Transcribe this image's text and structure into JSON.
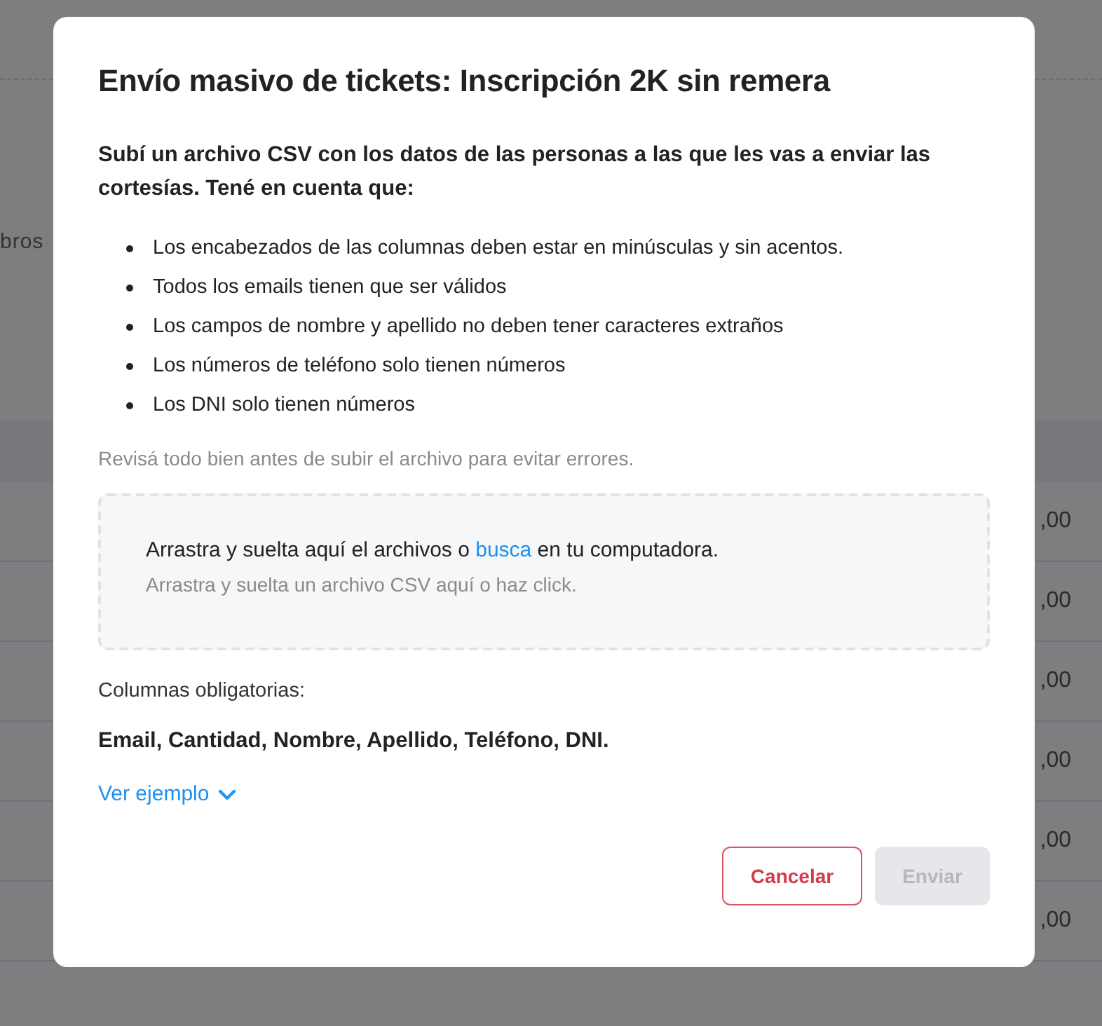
{
  "background": {
    "side_text": "bros",
    "amounts": [
      ",00",
      ",00",
      ",00",
      ",00",
      ",00",
      ",00"
    ]
  },
  "modal": {
    "title": "Envío masivo de tickets: Inscripción 2K sin remera",
    "intro": "Subí un archivo CSV con los datos de las personas a las que les vas a enviar las cortesías. Tené en cuenta que:",
    "rules": [
      "Los encabezados de las columnas deben estar en minúsculas y sin acentos.",
      "Todos los emails tienen que ser válidos",
      "Los campos de nombre y apellido no deben tener caracteres extraños",
      "Los números de teléfono solo tienen números",
      "Los DNI solo tienen números"
    ],
    "note": "Revisá todo bien antes de subir el archivo para evitar errores.",
    "dropzone": {
      "text_before": "Arrastra y suelta aquí el archivos o",
      "link": "busca",
      "text_after": "en tu computadora.",
      "hint": "Arrastra y suelta un archivo CSV aquí o haz click."
    },
    "required_label": "Columnas obligatorias:",
    "required_columns": "Email, Cantidad, Nombre, Apellido, Teléfono, DNI.",
    "example_link": {
      "label": "Ver ejemplo",
      "expanded": false
    },
    "buttons": [
      {
        "label": "Cancelar",
        "kind": "secondary",
        "disabled": false
      },
      {
        "label": "Enviar",
        "kind": "primary",
        "disabled": true
      }
    ]
  }
}
